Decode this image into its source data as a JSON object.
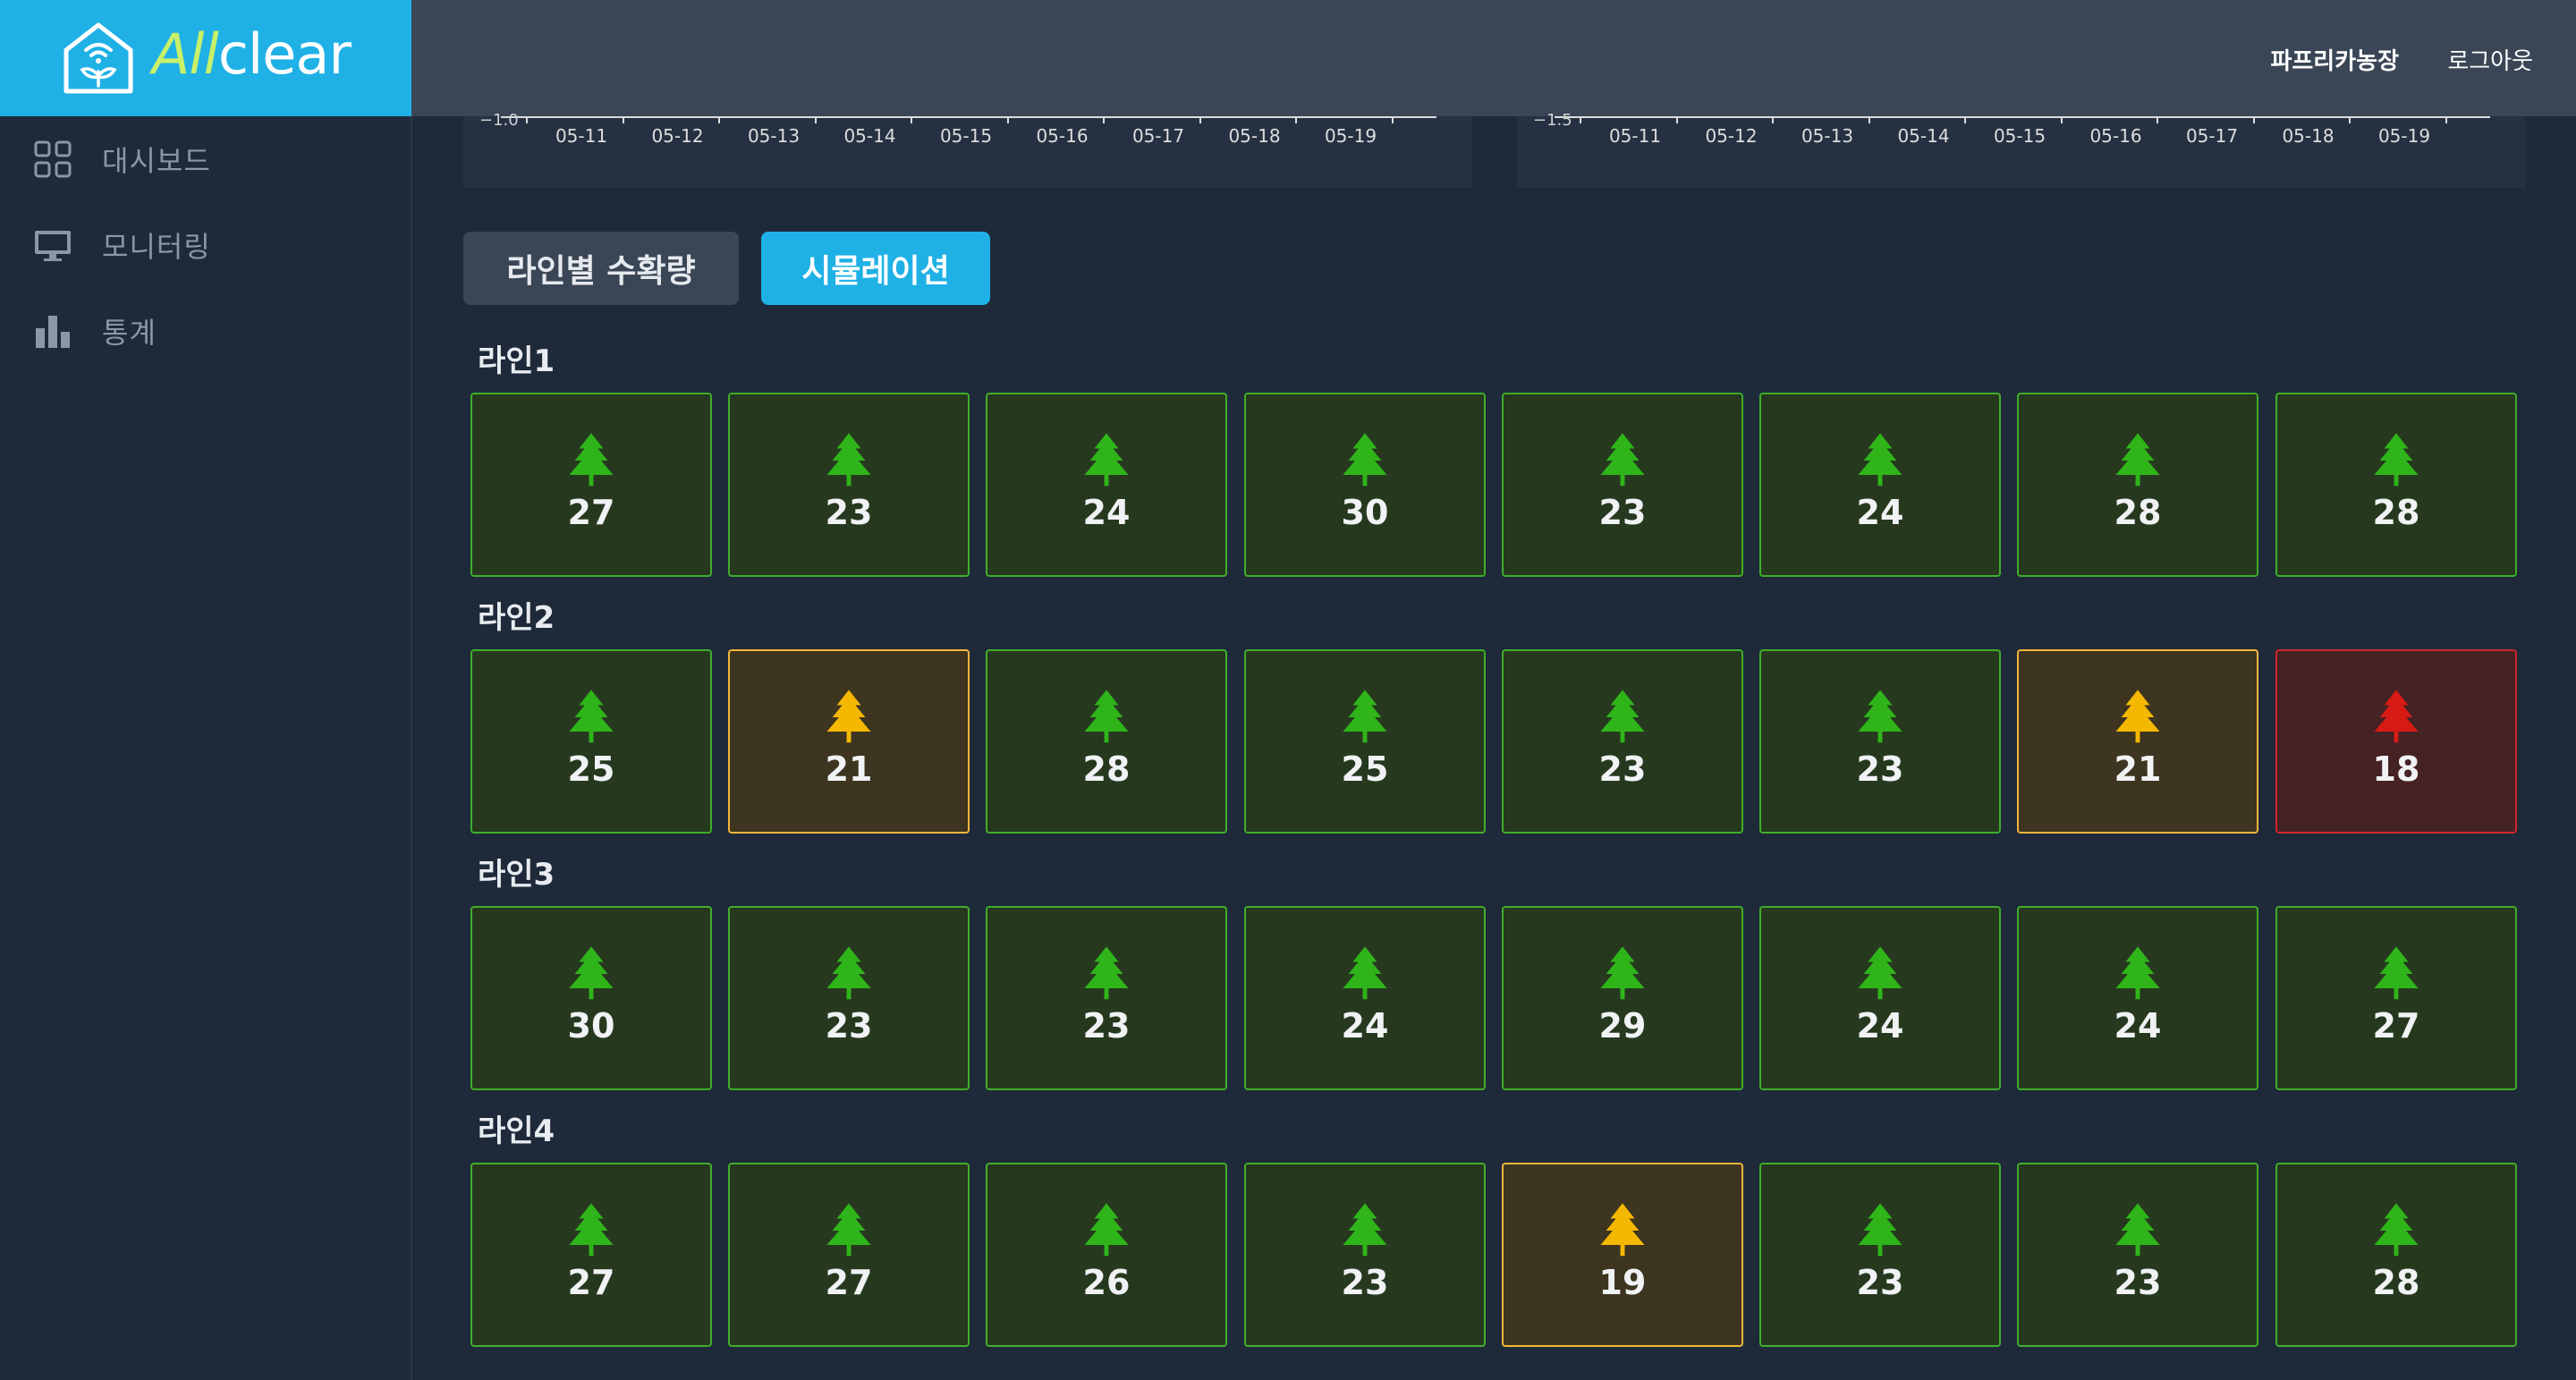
{
  "app": {
    "brand_prefix": "All",
    "brand_suffix": "clear"
  },
  "sidebar": {
    "items": [
      {
        "label": "대시보드",
        "icon": "grid-icon"
      },
      {
        "label": "모니터링",
        "icon": "monitor-icon"
      },
      {
        "label": "통계",
        "icon": "bar-chart-icon"
      }
    ]
  },
  "header": {
    "farm": "파프리카농장",
    "logout": "로그아웃"
  },
  "charts": [
    {
      "y_tick": "−1.0",
      "x_ticks": [
        "05-11",
        "05-12",
        "05-13",
        "05-14",
        "05-15",
        "05-16",
        "05-17",
        "05-18",
        "05-19"
      ]
    },
    {
      "y_tick": "−1.5",
      "x_ticks": [
        "05-11",
        "05-12",
        "05-13",
        "05-14",
        "05-15",
        "05-16",
        "05-17",
        "05-18",
        "05-19"
      ]
    }
  ],
  "tabs": {
    "harvest": "라인별 수확량",
    "simulation": "시뮬레이션"
  },
  "colors": {
    "ok": "#2fb51a",
    "warn": "#f5b800",
    "danger": "#d61a14",
    "accent": "#1fb1e6"
  },
  "lines": [
    {
      "title": "라인1",
      "cells": [
        {
          "value": "27",
          "status": "ok"
        },
        {
          "value": "23",
          "status": "ok"
        },
        {
          "value": "24",
          "status": "ok"
        },
        {
          "value": "30",
          "status": "ok"
        },
        {
          "value": "23",
          "status": "ok"
        },
        {
          "value": "24",
          "status": "ok"
        },
        {
          "value": "28",
          "status": "ok"
        },
        {
          "value": "28",
          "status": "ok"
        }
      ]
    },
    {
      "title": "라인2",
      "cells": [
        {
          "value": "25",
          "status": "ok"
        },
        {
          "value": "21",
          "status": "warn"
        },
        {
          "value": "28",
          "status": "ok"
        },
        {
          "value": "25",
          "status": "ok"
        },
        {
          "value": "23",
          "status": "ok"
        },
        {
          "value": "23",
          "status": "ok"
        },
        {
          "value": "21",
          "status": "warn"
        },
        {
          "value": "18",
          "status": "danger"
        }
      ]
    },
    {
      "title": "라인3",
      "cells": [
        {
          "value": "30",
          "status": "ok"
        },
        {
          "value": "23",
          "status": "ok"
        },
        {
          "value": "23",
          "status": "ok"
        },
        {
          "value": "24",
          "status": "ok"
        },
        {
          "value": "29",
          "status": "ok"
        },
        {
          "value": "24",
          "status": "ok"
        },
        {
          "value": "24",
          "status": "ok"
        },
        {
          "value": "27",
          "status": "ok"
        }
      ]
    },
    {
      "title": "라인4",
      "cells": [
        {
          "value": "27",
          "status": "ok"
        },
        {
          "value": "27",
          "status": "ok"
        },
        {
          "value": "26",
          "status": "ok"
        },
        {
          "value": "23",
          "status": "ok"
        },
        {
          "value": "19",
          "status": "warn"
        },
        {
          "value": "23",
          "status": "ok"
        },
        {
          "value": "23",
          "status": "ok"
        },
        {
          "value": "28",
          "status": "ok"
        }
      ]
    }
  ]
}
